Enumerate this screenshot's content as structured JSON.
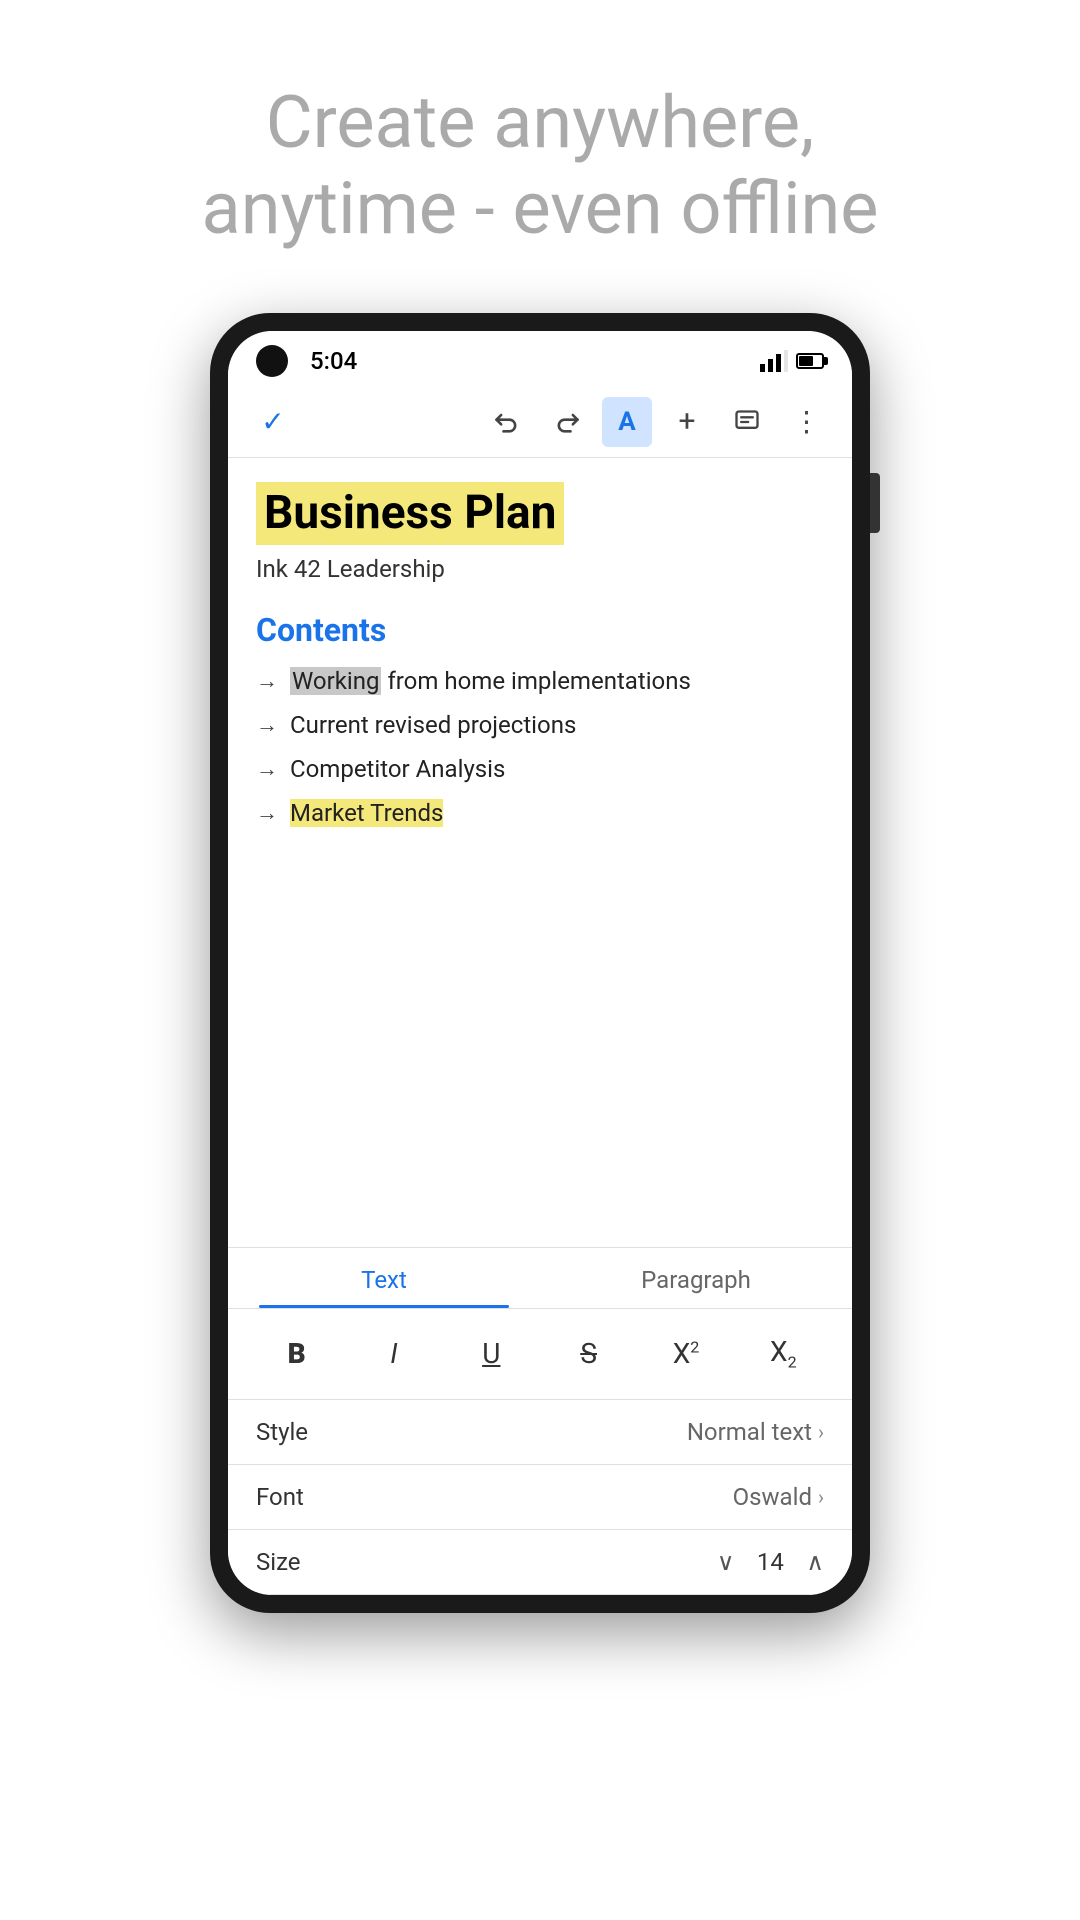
{
  "header": {
    "line1": "Create anywhere,",
    "line2": "anytime - even offline"
  },
  "statusBar": {
    "time": "5:04"
  },
  "toolbar": {
    "checkmark": "✓",
    "undo": "↺",
    "redo": "↻",
    "textFormat": "A",
    "add": "+",
    "comment": "☰",
    "more": "⋮"
  },
  "document": {
    "title": "Business Plan",
    "subtitle": "Ink 42 Leadership",
    "sectionTitle": "Contents",
    "listItems": [
      {
        "text": "Working",
        "rest": " from home implementations",
        "highlighted": true
      },
      {
        "text": "Current revised projections",
        "highlighted": false
      },
      {
        "text": "Competitor Analysis",
        "highlighted": false
      },
      {
        "text": "Market Trends",
        "highlighted": true,
        "yellowHighlight": true
      }
    ]
  },
  "bottomPanel": {
    "tabs": [
      {
        "label": "Text",
        "active": true
      },
      {
        "label": "Paragraph",
        "active": false
      }
    ],
    "formatButtons": [
      {
        "label": "B",
        "name": "bold"
      },
      {
        "label": "I",
        "name": "italic"
      },
      {
        "label": "U",
        "name": "underline"
      },
      {
        "label": "S",
        "name": "strikethrough"
      },
      {
        "label": "X²",
        "name": "superscript"
      },
      {
        "label": "X₂",
        "name": "subscript"
      }
    ],
    "styleRow": {
      "label": "Style",
      "value": "Normal text"
    },
    "fontRow": {
      "label": "Font",
      "value": "Oswald"
    },
    "sizeRow": {
      "label": "Size",
      "value": "14"
    }
  }
}
